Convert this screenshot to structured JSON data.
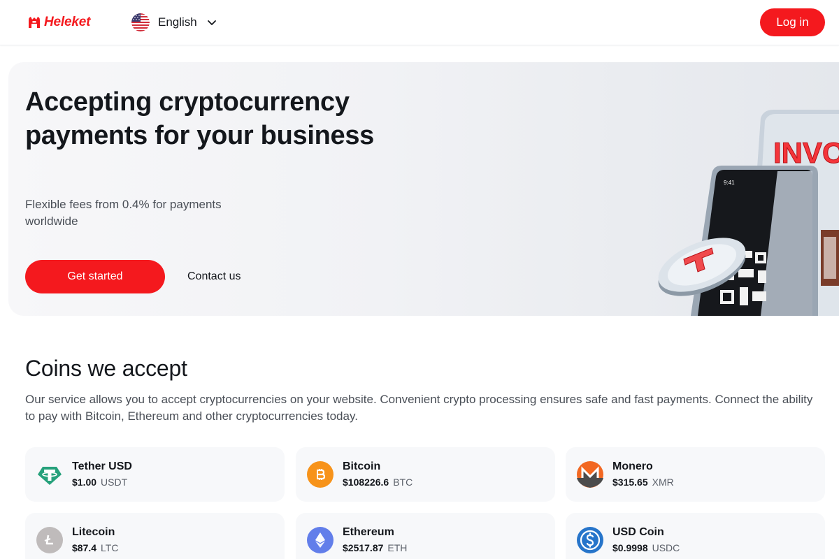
{
  "header": {
    "logo_text": "Heleket",
    "language": "English",
    "login_label": "Log in"
  },
  "hero": {
    "title": "Accepting cryptocurrency payments for your business",
    "subtitle": "Flexible fees from 0.4% for payments worldwide",
    "primary_button": "Get started",
    "secondary_link": "Contact us",
    "phone_time": "9:41",
    "invoice_text": "INVO"
  },
  "coins": {
    "title": "Coins we accept",
    "description": "Our service allows you to accept cryptocurrencies on your website. Convenient crypto processing ensures safe and fast payments. Connect the ability to pay with Bitcoin, Ethereum and other cryptocurrencies today.",
    "items": [
      {
        "name": "Tether USD",
        "price": "$1.00",
        "symbol": "USDT",
        "icon": "tether-icon",
        "color": "#26a17b"
      },
      {
        "name": "Bitcoin",
        "price": "$108226.6",
        "symbol": "BTC",
        "icon": "bitcoin-icon",
        "color": "#f7931a"
      },
      {
        "name": "Monero",
        "price": "$315.65",
        "symbol": "XMR",
        "icon": "monero-icon",
        "color": "#f26822"
      },
      {
        "name": "Litecoin",
        "price": "$87.4",
        "symbol": "LTC",
        "icon": "litecoin-icon",
        "color": "#bfbbbb"
      },
      {
        "name": "Ethereum",
        "price": "$2517.87",
        "symbol": "ETH",
        "icon": "ethereum-icon",
        "color": "#627eea"
      },
      {
        "name": "USD Coin",
        "price": "$0.9998",
        "symbol": "USDC",
        "icon": "usdc-icon",
        "color": "#2775ca"
      }
    ]
  },
  "colors": {
    "brand_red": "#f4191e",
    "text_dark": "#14171c",
    "text_muted": "#4a4f57",
    "card_bg": "#f7f8fa"
  }
}
